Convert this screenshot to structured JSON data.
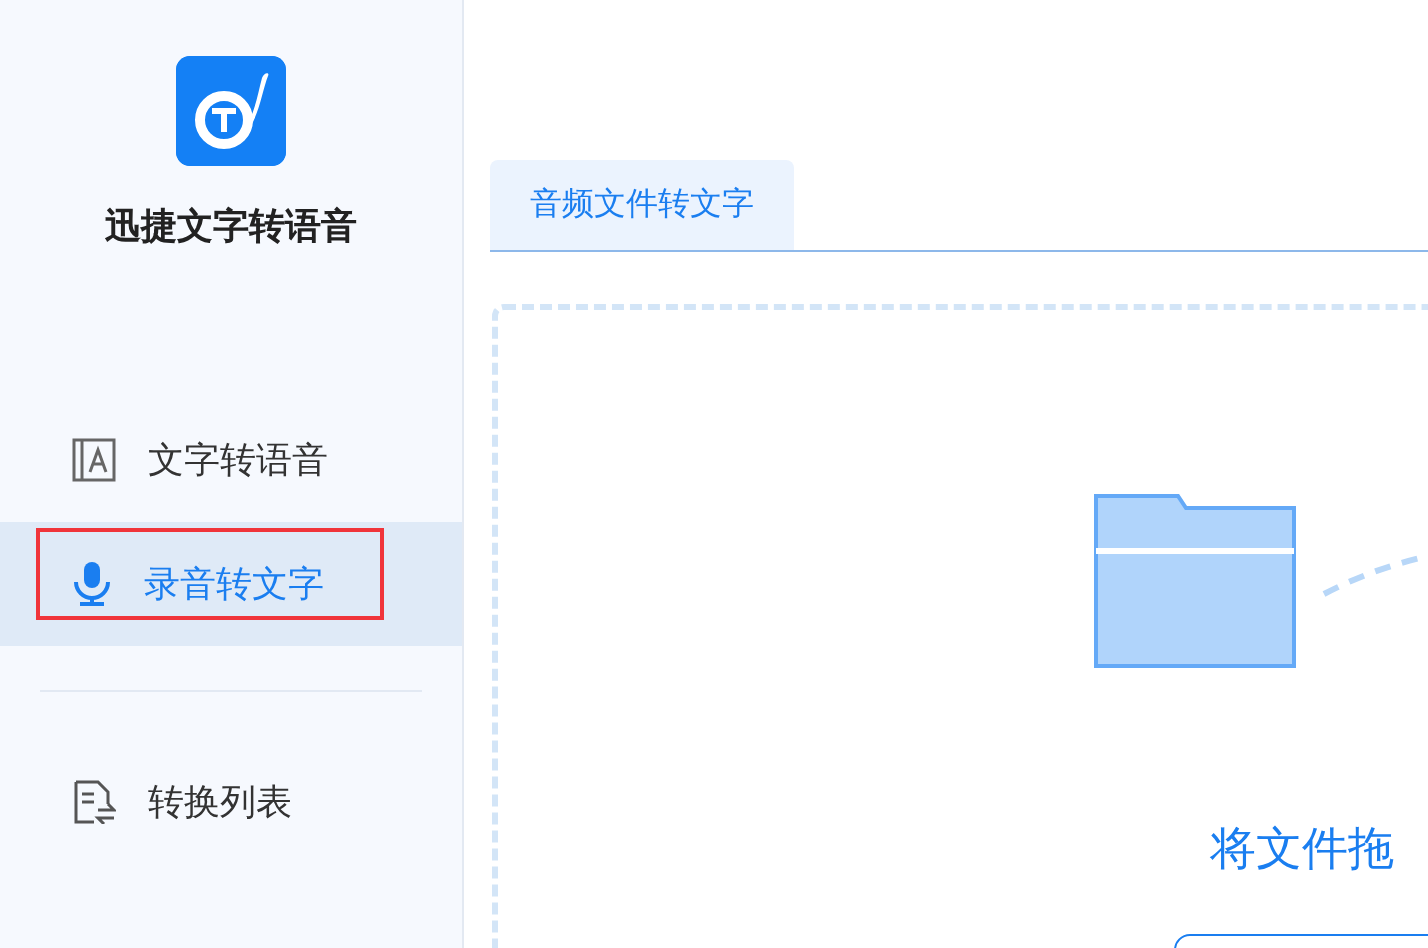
{
  "app": {
    "name": "迅捷文字转语音"
  },
  "sidebar": {
    "items": [
      {
        "kind": "text-to-speech",
        "label": "文字转语音",
        "selected": false
      },
      {
        "kind": "speech-to-text",
        "label": "录音转文字",
        "selected": true
      },
      {
        "kind": "divider"
      },
      {
        "kind": "list",
        "label": "转换列表",
        "selected": false
      }
    ]
  },
  "tabs": [
    {
      "label": "音频文件转文字",
      "selected": true
    }
  ],
  "drop_zone": {
    "text": "将文件拖"
  }
}
